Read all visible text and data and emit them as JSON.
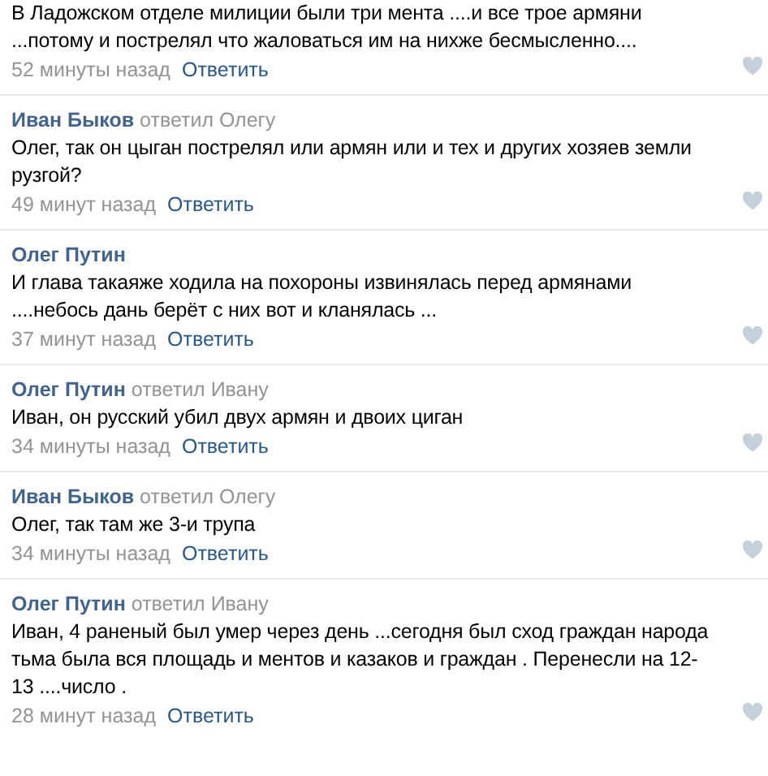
{
  "comments": [
    {
      "text_lines": [
        "В Ладожском отделе милиции были три мента ....и все трое армяни",
        "...потому и пострелял что жаловаться им на нихже бесмысленно...."
      ],
      "time": "52 минуты назад",
      "reply": "Ответить"
    },
    {
      "author": "Иван Быков",
      "replied_to": "ответил Олегу",
      "text_lines": [
        "Олег, так он цыган пострелял или армян или и тех и других хозяев земли",
        "рузгой?"
      ],
      "time": "49 минут назад",
      "reply": "Ответить"
    },
    {
      "author": "Олег Путин",
      "text_lines": [
        "И глава такаяже ходила на похороны извинялась перед армянами",
        "....небось дань берёт с них вот и кланялась ..."
      ],
      "time": "37 минут назад",
      "reply": "Ответить"
    },
    {
      "author": "Олег Путин",
      "replied_to": "ответил Ивану",
      "text_lines": [
        "Иван, он русский убил двух армян и двоих циган"
      ],
      "time": "34 минуты назад",
      "reply": "Ответить"
    },
    {
      "author": "Иван Быков",
      "replied_to": "ответил Олегу",
      "text_lines": [
        "Олег, так там же 3-и трупа"
      ],
      "time": "34 минуты назад",
      "reply": "Ответить"
    },
    {
      "author": "Олег Путин",
      "replied_to": "ответил Ивану",
      "text_lines": [
        "Иван, 4 раненый был умер через день ...сегодня был сход граждан народа",
        "тьма была вся площадь и ментов и казаков и граждан . Перенесли на 12-",
        "13 ....число ."
      ],
      "time": "28 минут назад",
      "reply": "Ответить"
    }
  ]
}
